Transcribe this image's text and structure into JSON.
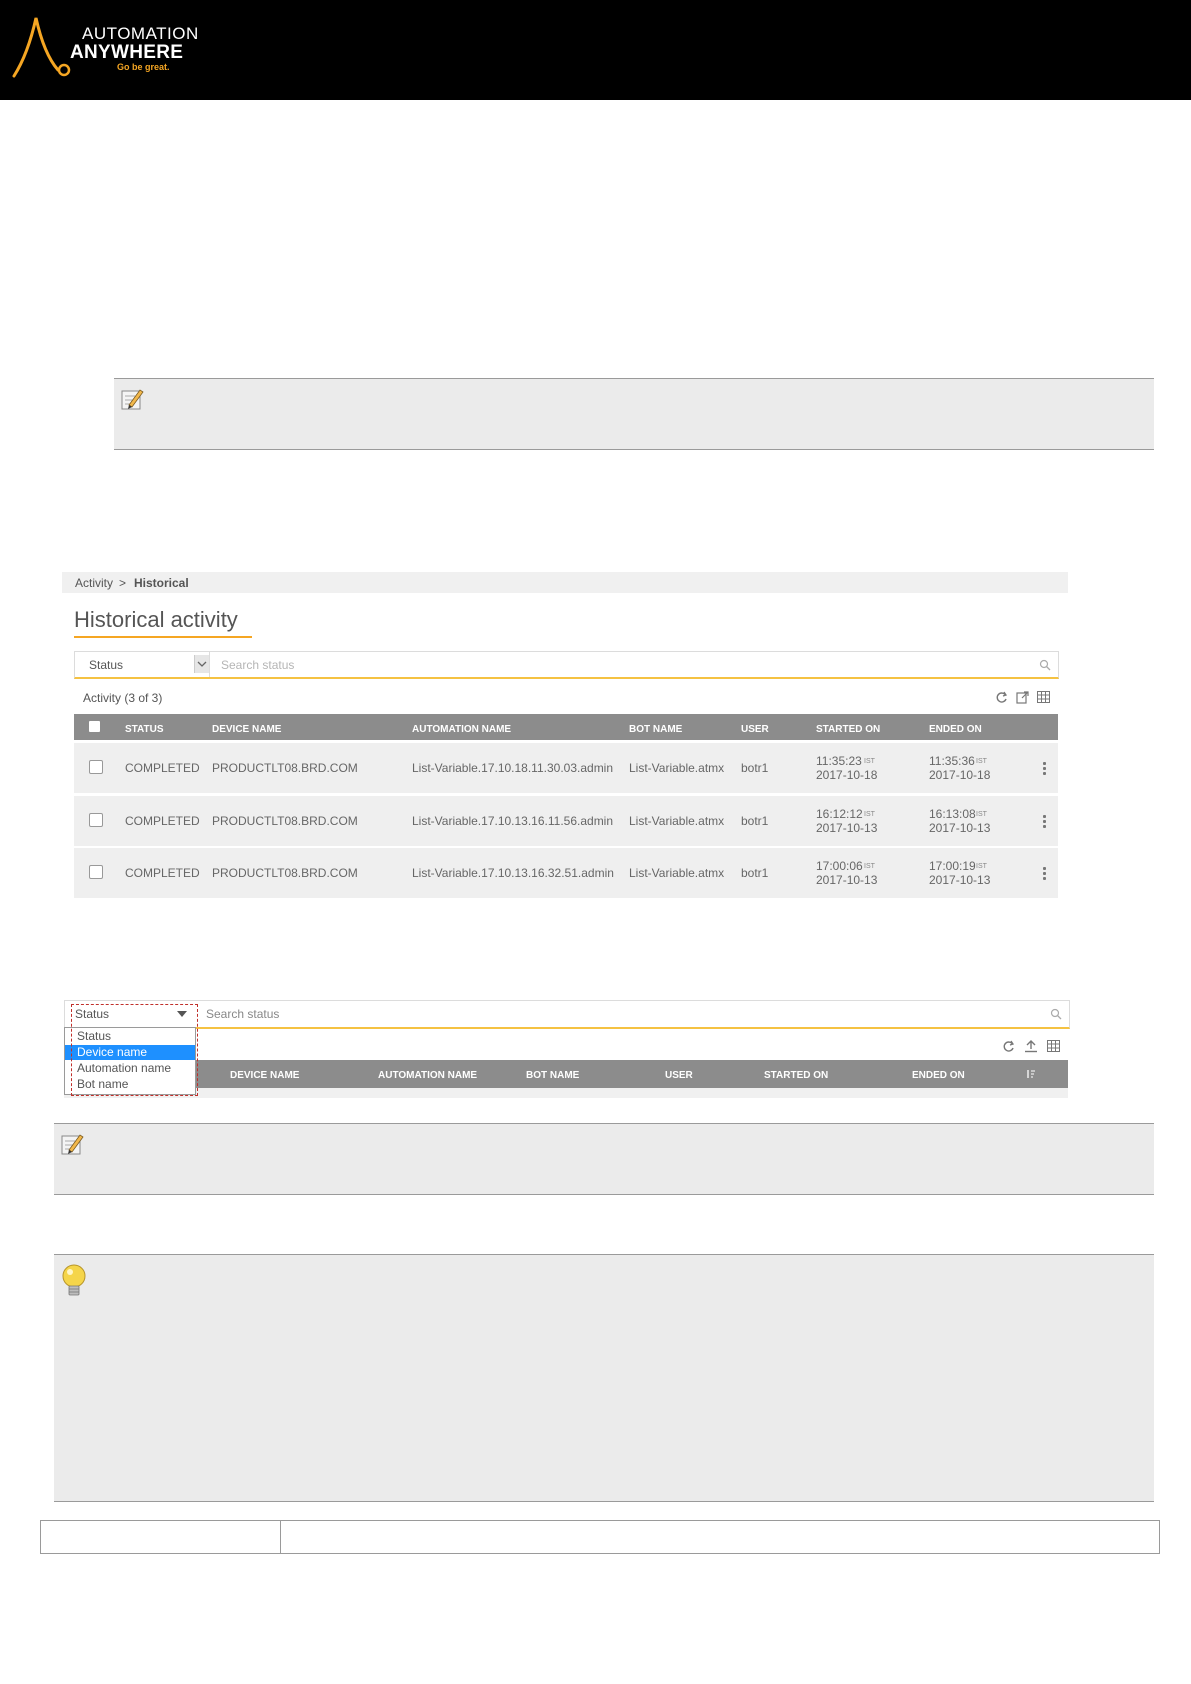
{
  "header": {
    "logo_line1": "AUTOMATION",
    "logo_line2": "ANYWHERE",
    "tagline": "Go be great.",
    "brand_color": "#f5a623"
  },
  "note_icon": "pencil-note-icon",
  "tip_icon": "lightbulb-icon",
  "screenshot1": {
    "breadcrumb": {
      "parent": "Activity",
      "separator": ">",
      "current": "Historical"
    },
    "title": "Historical activity",
    "filter": {
      "selected": "Status",
      "placeholder": "Search status"
    },
    "count_label": "Activity (3 of 3)",
    "columns": [
      "STATUS",
      "DEVICE NAME",
      "AUTOMATION NAME",
      "BOT NAME",
      "USER",
      "STARTED ON",
      "ENDED ON"
    ],
    "rows": [
      {
        "status": "COMPLETED",
        "device": "PRODUCTLT08.BRD.COM",
        "automation": "List-Variable.17.10.18.11.30.03.admin",
        "bot": "List-Variable.atmx",
        "user": "botr1",
        "started_time": "11:35:23",
        "started_date": "2017-10-18",
        "ended_time": "11:35:36",
        "ended_date": "2017-10-18",
        "tz": "IST"
      },
      {
        "status": "COMPLETED",
        "device": "PRODUCTLT08.BRD.COM",
        "automation": "List-Variable.17.10.13.16.11.56.admin",
        "bot": "List-Variable.atmx",
        "user": "botr1",
        "started_time": "16:12:12",
        "started_date": "2017-10-13",
        "ended_time": "16:13:08",
        "ended_date": "2017-10-13",
        "tz": "IST"
      },
      {
        "status": "COMPLETED",
        "device": "PRODUCTLT08.BRD.COM",
        "automation": "List-Variable.17.10.13.16.32.51.admin",
        "bot": "List-Variable.atmx",
        "user": "botr1",
        "started_time": "17:00:06",
        "started_date": "2017-10-13",
        "ended_time": "17:00:19",
        "ended_date": "2017-10-13",
        "tz": "IST"
      }
    ]
  },
  "screenshot2": {
    "filter": {
      "selected": "Status",
      "placeholder": "Search status"
    },
    "options": [
      "Status",
      "Device name",
      "Automation name",
      "Bot name"
    ],
    "highlighted_option": "Device name",
    "columns": [
      "DEVICE NAME",
      "AUTOMATION NAME",
      "BOT NAME",
      "USER",
      "STARTED ON",
      "ENDED ON"
    ]
  }
}
